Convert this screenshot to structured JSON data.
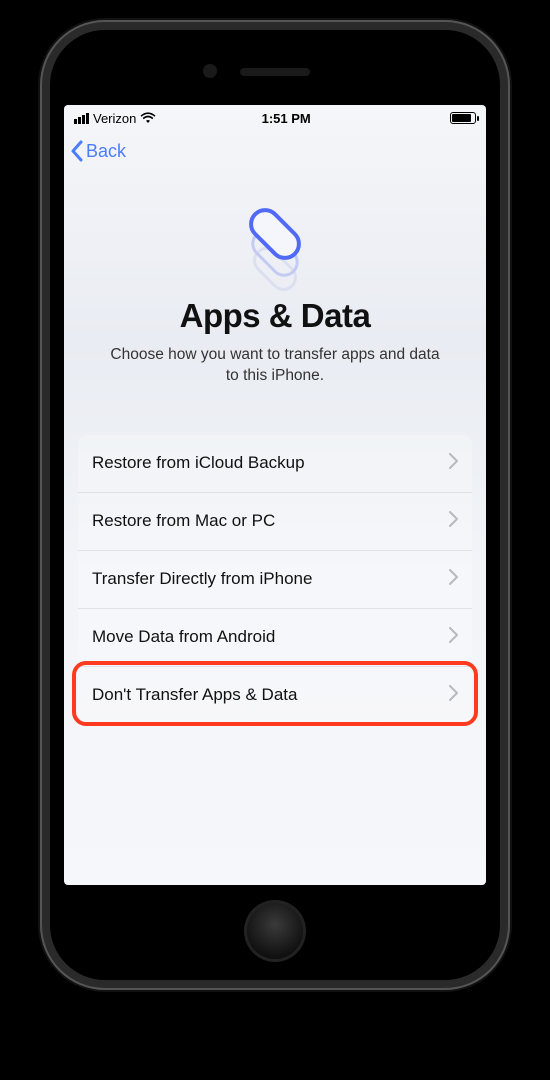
{
  "status_bar": {
    "carrier": "Verizon",
    "time": "1:51 PM"
  },
  "nav": {
    "back_label": "Back"
  },
  "page": {
    "title": "Apps & Data",
    "subtitle": "Choose how you want to transfer apps and data to this iPhone."
  },
  "options": [
    {
      "label": "Restore from iCloud Backup",
      "highlighted": false
    },
    {
      "label": "Restore from Mac or PC",
      "highlighted": false
    },
    {
      "label": "Transfer Directly from iPhone",
      "highlighted": false
    },
    {
      "label": "Move Data from Android",
      "highlighted": false
    },
    {
      "label": "Don't Transfer Apps & Data",
      "highlighted": true
    }
  ],
  "colors": {
    "accent_blue": "#4a7dff",
    "highlight_red": "#ff3b1f"
  }
}
